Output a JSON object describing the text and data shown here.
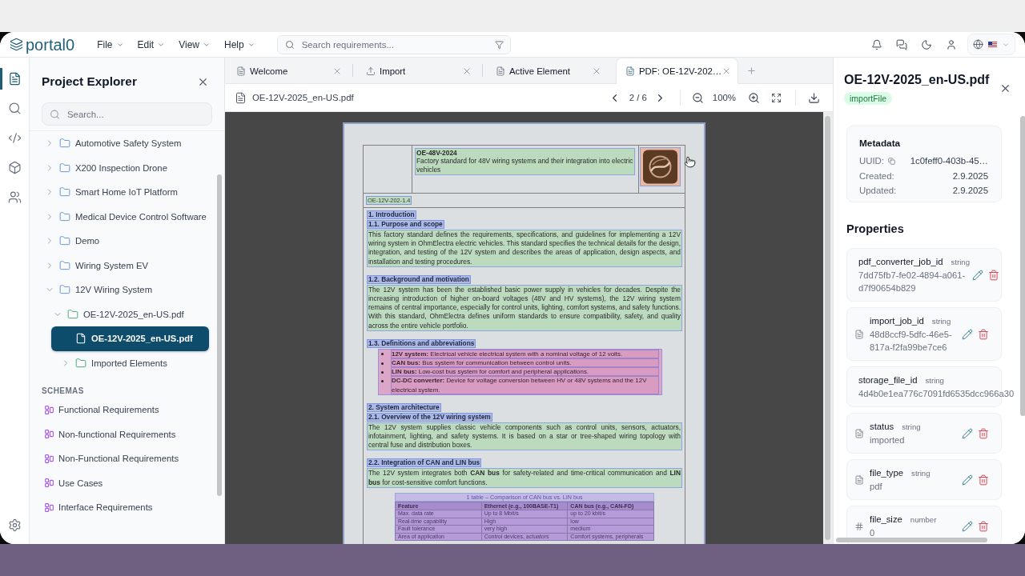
{
  "header": {
    "logo": "portal0",
    "menus": [
      "File",
      "Edit",
      "View",
      "Help"
    ],
    "search": {
      "placeholder": "Search requirements..."
    }
  },
  "rail": {
    "items": [
      {
        "kind": "explorer",
        "selected": true
      },
      {
        "kind": "search",
        "selected": false
      },
      {
        "kind": "code",
        "selected": false
      },
      {
        "kind": "models",
        "selected": false
      },
      {
        "kind": "team",
        "selected": false
      },
      {
        "kind": "settings",
        "selected": false
      }
    ]
  },
  "sidebar": {
    "title": "Project Explorer",
    "search": {
      "placeholder": "Search..."
    },
    "tree": [
      {
        "label": "Automotive Safety System",
        "kind": "project",
        "expanded": false,
        "selected": false
      },
      {
        "label": "X200 Inspection Drone",
        "kind": "project",
        "expanded": false,
        "selected": false
      },
      {
        "label": "Smart Home IoT Platform",
        "kind": "project",
        "expanded": false,
        "selected": false
      },
      {
        "label": "Medical Device Control Software",
        "kind": "project",
        "expanded": false,
        "selected": false
      },
      {
        "label": "Demo",
        "kind": "project",
        "expanded": false,
        "selected": false
      },
      {
        "label": "Wiring System EV",
        "kind": "project",
        "expanded": false,
        "selected": false
      },
      {
        "label": "12V Wiring System",
        "kind": "project",
        "expanded": true,
        "selected": false,
        "children": [
          {
            "label": "OE-12V-2025_en-US.pdf",
            "kind": "import",
            "expanded": true,
            "selected": false,
            "children": [
              {
                "label": "OE-12V-2025_en-US.pdf",
                "kind": "file",
                "selected": true
              },
              {
                "label": "Imported Elements",
                "kind": "import",
                "expanded": false,
                "selected": false
              }
            ]
          }
        ]
      }
    ],
    "schemas": {
      "heading": "SCHEMAS",
      "items": [
        {
          "label": "Functional Requirements",
          "selected": false
        },
        {
          "label": "Non-functional Requirements",
          "selected": false
        },
        {
          "label": "Non-Functional Requirements",
          "selected": false
        },
        {
          "label": "Use Cases",
          "selected": false
        },
        {
          "label": "Interface Requirements",
          "selected": false
        }
      ]
    }
  },
  "editor": {
    "tabs": [
      {
        "label": "Welcome",
        "kind": "page",
        "selected": false
      },
      {
        "label": "Import",
        "kind": "upload",
        "selected": false
      },
      {
        "label": "Active Element",
        "kind": "page",
        "selected": false
      },
      {
        "label": "PDF: OE-12V-202…",
        "kind": "page",
        "selected": true
      }
    ],
    "toolbar": {
      "file_name": "OE-12V-2025_en-US.pdf",
      "page": "2 / 6",
      "zoom": "100%"
    },
    "document": {
      "header": {
        "code": "OE-48V-2024",
        "title": "Factory standard for 48V wiring systems and their integration into electric vehicles",
        "doc_id": "OE-12V-202-1.4"
      },
      "blocks": [
        {
          "kind": "heading",
          "text": "1. Introduction"
        },
        {
          "kind": "heading",
          "text": "1.1. Purpose and scope"
        },
        {
          "kind": "paragraph",
          "text": "This factory standard defines the requirements, specifications, and guidelines for implementing a 12V wiring system in OhmElectra electric vehicles. This standard specifies the technical details for the design, integration, and testing of the 12V system and describes the areas of application, design aspects, and installation and testing procedures."
        },
        {
          "kind": "heading",
          "text": "1.2. Background and motivation"
        },
        {
          "kind": "paragraph",
          "text": "The 12V system has been the established basic power supply in vehicles for decades. Despite the increasing introduction of higher on-board voltages (48V and HV systems), the 12V wiring system remains of central importance, especially for control units, lighting, comfort systems, and safety functions. With this standard, OhmElectra defines uniform standards to ensure compatibility, safety, and quality across the entire vehicle portfolio."
        },
        {
          "kind": "heading",
          "text": "1.3. Definitions and abbreviations"
        },
        {
          "kind": "list",
          "items": [
            "**12V system:** Electrical vehicle electrical system with a nominal voltage of 12 volts.",
            "**CAN bus:** Bus system for communication between control units.",
            "**LIN bus:** Low-cost bus system for comfort and peripheral applications.",
            "**DC-DC converter:** Device for voltage conversion between HV or 48V systems and the 12V electrical system."
          ]
        },
        {
          "kind": "heading",
          "text": "2. System architecture"
        },
        {
          "kind": "heading",
          "text": "2.1. Overview of the 12V wiring system"
        },
        {
          "kind": "paragraph",
          "text": "The 12V system supplies classic vehicle components such as control units, sensors, actuators, infotainment, lighting, and safety systems. It is based on a star or tree-shaped wiring topology with central fuse and distribution boxes."
        },
        {
          "kind": "heading",
          "text": "2.2. Integration of CAN and LIN bus"
        },
        {
          "kind": "paragraph",
          "text": "The 12V system integrates both **CAN bus** for safety-related and time-critical communication and **LIN bus** for cost-sensitive comfort functions."
        },
        {
          "kind": "table",
          "caption": "1 table – Comparison of CAN bus vs. LIN bus",
          "columns": [
            "Feature",
            "Ethernet (e.g., 100BASE-T1)",
            "CAN bus (e.g., CAN-FD)"
          ],
          "rows": [
            [
              "Max. data rate",
              "Up to 8 Mbit/s",
              "up to 20 kbit/s"
            ],
            [
              "Real-time capability",
              "High",
              "low"
            ],
            [
              "Fault tolerance",
              "very high",
              "medium"
            ],
            [
              "Area of application",
              "Control devices, actuators",
              "Comfort systems, peripherals"
            ]
          ]
        }
      ]
    }
  },
  "details": {
    "title": "OE-12V-2025_en-US.pdf",
    "badge": "importFile",
    "metadata": {
      "heading": "Metadata",
      "rows": [
        {
          "label": "UUID:",
          "value": "1c0feff0-403b-45…",
          "copyable": true
        },
        {
          "label": "Created:",
          "value": "2.9.2025",
          "copyable": false
        },
        {
          "label": "Updated:",
          "value": "2.9.2025",
          "copyable": false
        }
      ]
    },
    "properties": {
      "heading": "Properties",
      "items": [
        {
          "name": "pdf_converter_job_id",
          "type": "string",
          "value": "7dd75fb7-fe02-4894-a061-d7f90654b829",
          "kind": "bare",
          "show_actions": true
        },
        {
          "name": "import_job_id",
          "type": "string",
          "value": "48d8ccf9-5dfc-46e5-817a-f2fa99be7ce6",
          "kind": "text",
          "show_actions": true
        },
        {
          "name": "storage_file_id",
          "type": "string",
          "value": "4d4b0e1ea776c7091fd6535dcc966a30",
          "kind": "bare",
          "show_actions": false
        },
        {
          "name": "status",
          "type": "string",
          "value": "imported",
          "kind": "text",
          "show_actions": true
        },
        {
          "name": "file_type",
          "type": "string",
          "value": "pdf",
          "kind": "text",
          "show_actions": true
        },
        {
          "name": "file_size",
          "type": "number",
          "value": "0",
          "kind": "number",
          "show_actions": true
        }
      ]
    }
  }
}
